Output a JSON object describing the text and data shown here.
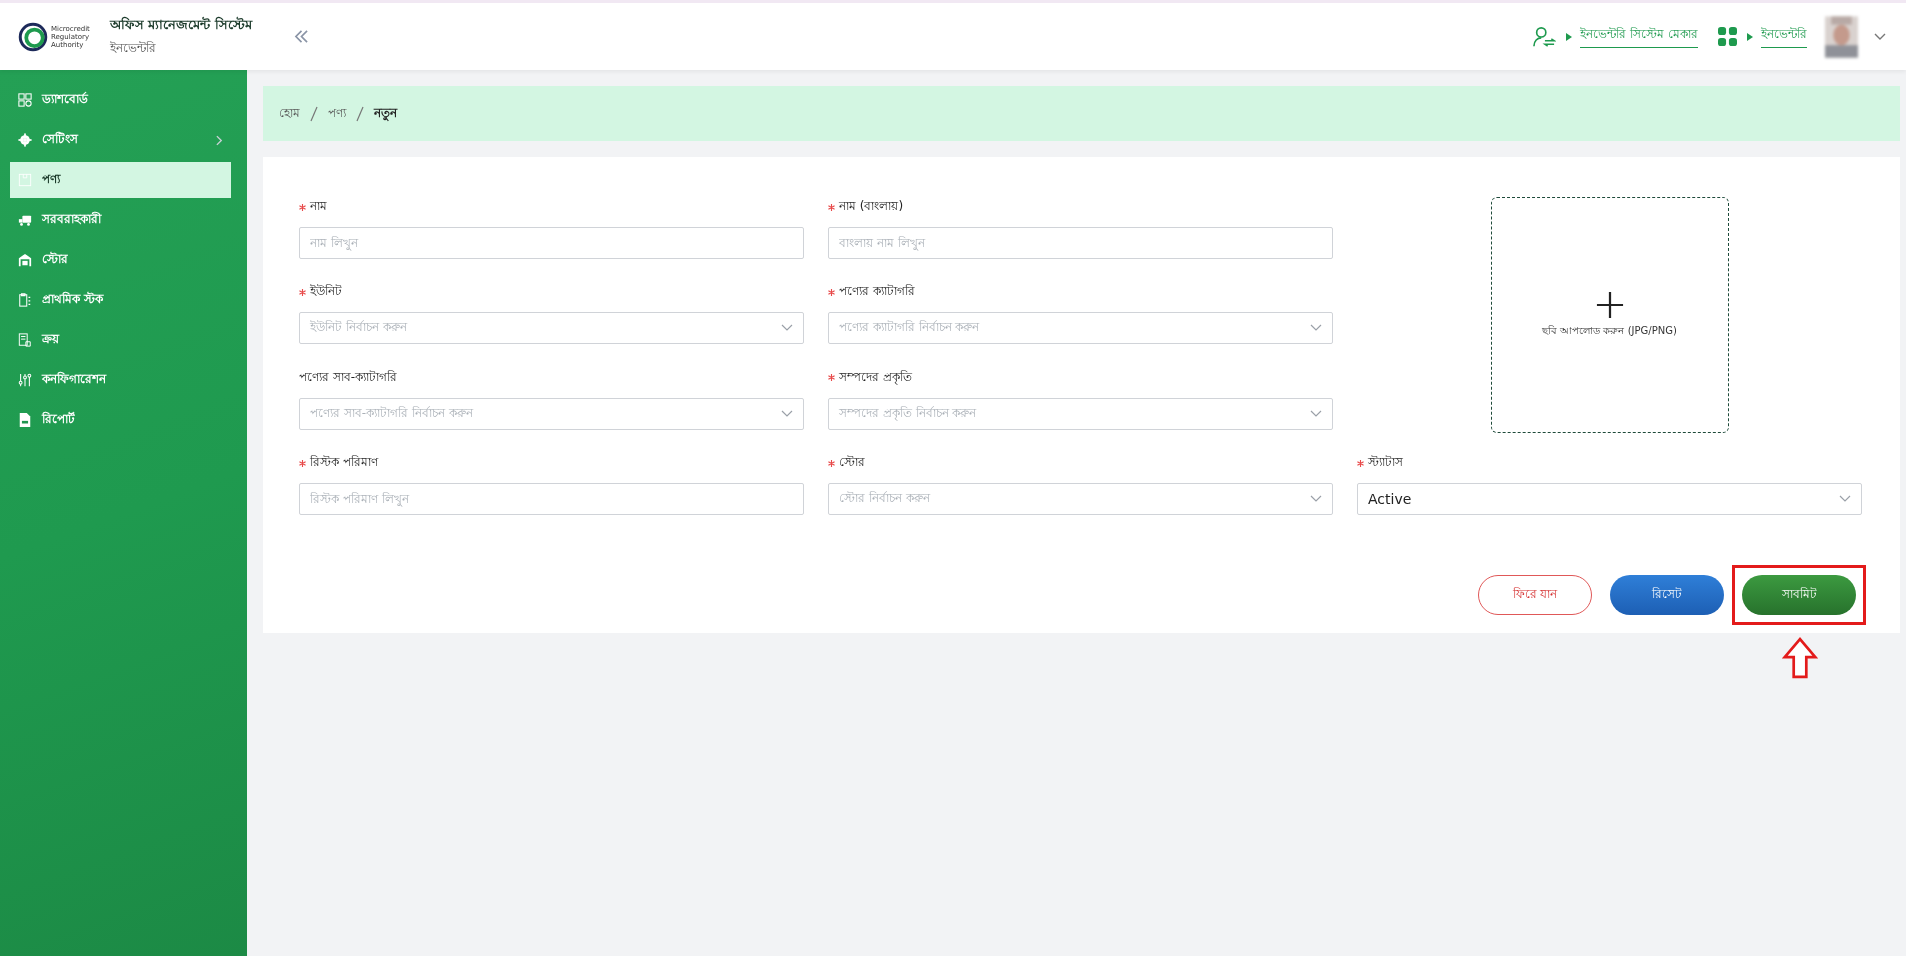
{
  "header": {
    "logo_lines": [
      "Microcredit",
      "Regulatory",
      "Authority"
    ],
    "app_title": "অফিস ম্যানেজমেন্ট সিস্টেম",
    "app_subtitle": "ইনভেন্টরি",
    "role_link": "ইনভেন্টরি সিস্টেম মেকার",
    "module_link": "ইনভেন্টরি"
  },
  "sidebar": {
    "items": [
      {
        "label": "ড্যাশবোর্ড",
        "selected": false,
        "has_submenu": false
      },
      {
        "label": "সেটিংস",
        "selected": false,
        "has_submenu": true
      },
      {
        "label": "পণ্য",
        "selected": true,
        "has_submenu": false
      },
      {
        "label": "সরবরাহকারী",
        "selected": false,
        "has_submenu": false
      },
      {
        "label": "স্টোর",
        "selected": false,
        "has_submenu": false
      },
      {
        "label": "প্রাথমিক স্টক",
        "selected": false,
        "has_submenu": false
      },
      {
        "label": "ক্রয়",
        "selected": false,
        "has_submenu": false
      },
      {
        "label": "কনফিগারেশন",
        "selected": false,
        "has_submenu": false
      },
      {
        "label": "রিপোর্ট",
        "selected": false,
        "has_submenu": false
      }
    ]
  },
  "breadcrumb": [
    "হোম",
    "পণ্য",
    "নতুন"
  ],
  "form": {
    "fields": [
      {
        "kind": "input",
        "required": true,
        "label": "নাম",
        "placeholder": "নাম লিখুন"
      },
      {
        "kind": "input",
        "required": true,
        "label": "নাম (বাংলায়)",
        "placeholder": "বাংলায় নাম লিখুন"
      },
      {
        "kind": "select",
        "required": true,
        "label": "ইউনিট",
        "placeholder": "ইউনিট নির্বাচন করুন"
      },
      {
        "kind": "select",
        "required": true,
        "label": "পণ্যের ক্যাটাগরি",
        "placeholder": "পণ্যের ক্যাটাগরি নির্বাচন করুন"
      },
      {
        "kind": "select",
        "required": false,
        "label": "পণ্যের সাব-ক্যাটাগরি",
        "placeholder": "পণ্যের সাব-ক্যাটাগরি নির্বাচন করুন"
      },
      {
        "kind": "select",
        "required": true,
        "label": "সম্পদের প্রকৃতি",
        "placeholder": "সম্পদের প্রকৃতি নির্বাচন করুন"
      },
      {
        "kind": "input",
        "required": true,
        "label": "রিস্টক পরিমাণ",
        "placeholder": "রিস্টক পরিমাণ লিখুন"
      },
      {
        "kind": "select",
        "required": true,
        "label": "স্টোর",
        "placeholder": "স্টোর নির্বাচন করুন"
      },
      {
        "kind": "select",
        "required": true,
        "label": "স্ট্যাটাস",
        "value": "Active"
      }
    ],
    "upload": {
      "hint": "ছবি আপলোড করুন (JPG/PNG)"
    },
    "buttons": [
      {
        "kind": "back",
        "label": "ফিরে যান"
      },
      {
        "kind": "reset",
        "label": "রিসেট"
      },
      {
        "kind": "submit",
        "label": "সাবমিট",
        "highlighted": true
      }
    ]
  }
}
